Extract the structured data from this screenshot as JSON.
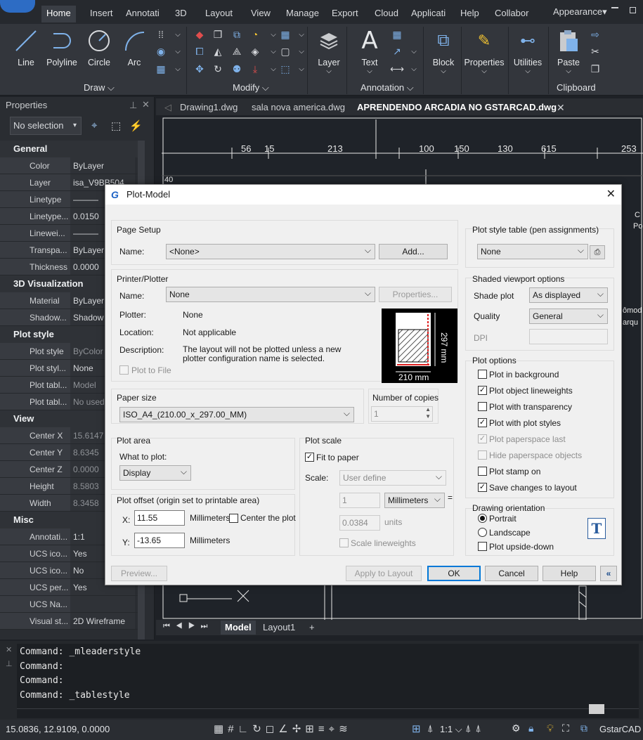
{
  "ribbon": {
    "tabs": [
      "Home",
      "Insert",
      "Annotati",
      "3D",
      "Layout",
      "View",
      "Manage",
      "Export",
      "Cloud",
      "Applicati",
      "Help",
      "Collabor"
    ],
    "active_tab": "Home",
    "appearance": "Appearance",
    "panels": {
      "draw": {
        "title": "Draw",
        "buttons": [
          "Line",
          "Polyline",
          "Circle",
          "Arc"
        ]
      },
      "modify": {
        "title": "Modify"
      },
      "layer": {
        "label": "Layer"
      },
      "annotation": {
        "title": "Annotation",
        "text_label": "Text"
      },
      "block": {
        "label": "Block"
      },
      "properties": {
        "label": "Properties"
      },
      "utilities": {
        "label": "Utilities"
      },
      "clipboard": {
        "title": "Clipboard",
        "paste_label": "Paste"
      }
    }
  },
  "properties": {
    "title": "Properties",
    "selection": "No selection",
    "sections": [
      {
        "name": "General",
        "rows": [
          {
            "k": "Color",
            "v": "ByLayer"
          },
          {
            "k": "Layer",
            "v": "isa_V9BB504"
          },
          {
            "k": "Linetype",
            "v": "———"
          },
          {
            "k": "Linetype...",
            "v": "0.0150"
          },
          {
            "k": "Linewei...",
            "v": "———"
          },
          {
            "k": "Transpa...",
            "v": "ByLayer"
          },
          {
            "k": "Thickness",
            "v": "0.0000"
          }
        ]
      },
      {
        "name": "3D Visualization",
        "rows": [
          {
            "k": "Material",
            "v": "ByLayer"
          },
          {
            "k": "Shadow...",
            "v": "Shadow"
          }
        ]
      },
      {
        "name": "Plot style",
        "rows": [
          {
            "k": "Plot style",
            "v": "ByColor"
          },
          {
            "k": "Plot styl...",
            "v": "None"
          },
          {
            "k": "Plot tabl...",
            "v": "Model"
          },
          {
            "k": "Plot tabl...",
            "v": "No used"
          }
        ]
      },
      {
        "name": "View",
        "rows": [
          {
            "k": "Center X",
            "v": "15.6147"
          },
          {
            "k": "Center Y",
            "v": "8.6345"
          },
          {
            "k": "Center Z",
            "v": "0.0000"
          },
          {
            "k": "Height",
            "v": "8.5803"
          },
          {
            "k": "Width",
            "v": "8.3458"
          }
        ]
      },
      {
        "name": "Misc",
        "rows": [
          {
            "k": "Annotati...",
            "v": "1:1"
          },
          {
            "k": "UCS ico...",
            "v": "Yes"
          },
          {
            "k": "UCS ico...",
            "v": "No"
          },
          {
            "k": "UCS per...",
            "v": "Yes"
          },
          {
            "k": "UCS Na...",
            "v": ""
          },
          {
            "k": "Visual st...",
            "v": "2D Wireframe"
          }
        ]
      }
    ]
  },
  "documents": {
    "tabs": [
      "Drawing1.dwg",
      "sala nova america.dwg",
      "APRENDENDO ARCADIA NO GSTARCAD.dwg"
    ],
    "active": "APRENDENDO ARCADIA NO GSTARCAD.dwg"
  },
  "drawing": {
    "dims": [
      "56",
      "15",
      "213",
      "100",
      "150",
      "130",
      "615",
      "253"
    ],
    "side_text": [
      "40",
      "C",
      "Po",
      "ômod",
      "arqu"
    ]
  },
  "layout_tabs": [
    "Model",
    "Layout1",
    "+"
  ],
  "command": {
    "lines": [
      "Command: _mleaderstyle",
      "Command:",
      "Command:",
      "Command: _tablestyle"
    ]
  },
  "status": {
    "coords": "15.0836, 12.9109, 0.0000",
    "scale": "1:1",
    "app": "GstarCAD"
  },
  "dialog": {
    "title": "Plot-Model",
    "page_setup": {
      "group": "Page Setup",
      "name_label": "Name:",
      "name_value": "<None>",
      "add_label": "Add..."
    },
    "printer": {
      "group": "Printer/Plotter",
      "name_label": "Name:",
      "name_value": "None",
      "properties_label": "Properties...",
      "plotter_label": "Plotter:",
      "plotter_value": "None",
      "location_label": "Location:",
      "location_value": "Not applicable",
      "description_label": "Description:",
      "description_value": "The layout will not be plotted unless a new plotter configuration name is selected.",
      "plot_to_file": "Plot to File",
      "preview_width": "210 mm",
      "preview_height": "297 mm"
    },
    "paper_size": {
      "group": "Paper size",
      "value": "ISO_A4_(210.00_x_297.00_MM)"
    },
    "copies": {
      "group": "Number of copies",
      "value": "1"
    },
    "plot_area": {
      "group": "Plot area",
      "what_label": "What to plot:",
      "what_value": "Display"
    },
    "plot_offset": {
      "group": "Plot offset (origin set to printable area)",
      "x_label": "X:",
      "x_value": "11.55",
      "x_unit": "Millimeters",
      "y_label": "Y:",
      "y_value": "-13.65",
      "y_unit": "Millimeters",
      "center_label": "Center the plot"
    },
    "plot_scale": {
      "group": "Plot scale",
      "fit_label": "Fit to paper",
      "scale_label": "Scale:",
      "scale_value": "User define",
      "num_value": "1",
      "unit_value": "Millimeters",
      "equals": "=",
      "den_value": "0.0384",
      "den_unit": "units",
      "lineweights_label": "Scale lineweights"
    },
    "style_table": {
      "group": "Plot style table (pen assignments)",
      "value": "None"
    },
    "shaded": {
      "group": "Shaded viewport options",
      "shade_label": "Shade plot",
      "shade_value": "As displayed",
      "quality_label": "Quality",
      "quality_value": "General",
      "dpi_label": "DPI"
    },
    "plot_options": {
      "group": "Plot options",
      "items": [
        "Plot in background",
        "Plot object lineweights",
        "Plot with transparency",
        "Plot with plot styles",
        "Plot paperspace last",
        "Hide paperspace objects",
        "Plot stamp on",
        "Save changes to layout"
      ]
    },
    "orientation": {
      "group": "Drawing orientation",
      "portrait": "Portrait",
      "landscape": "Landscape",
      "upside": "Plot upside-down",
      "icon_letter": "T"
    },
    "buttons": {
      "preview": "Preview...",
      "apply": "Apply to Layout",
      "ok": "OK",
      "cancel": "Cancel",
      "help": "Help",
      "collapse": "«"
    }
  }
}
